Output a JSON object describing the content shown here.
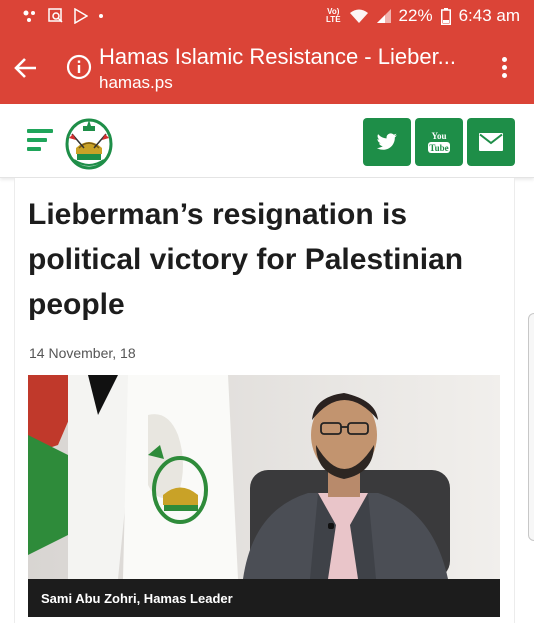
{
  "status_bar": {
    "battery": "22%",
    "time": "6:43 am",
    "network": "Vo) LTE"
  },
  "tab_bar": {
    "title": "Hamas Islamic Resistance - Lieber...",
    "url": "hamas.ps"
  },
  "header": {
    "social": [
      {
        "icon": "twitter-icon"
      },
      {
        "icon": "youtube-icon",
        "label_top": "You",
        "label_bottom": "Tube"
      },
      {
        "icon": "mail-icon"
      }
    ],
    "accent_color": "#1e8e48"
  },
  "article": {
    "headline": "Lieberman’s resignation is political victory for Palestinian people",
    "date": "14 November, 18",
    "photo_caption": "Sami Abu Zohri, Hamas Leader"
  },
  "colors": {
    "chrome_red": "#db4437",
    "brand_green": "#1fa55a"
  }
}
